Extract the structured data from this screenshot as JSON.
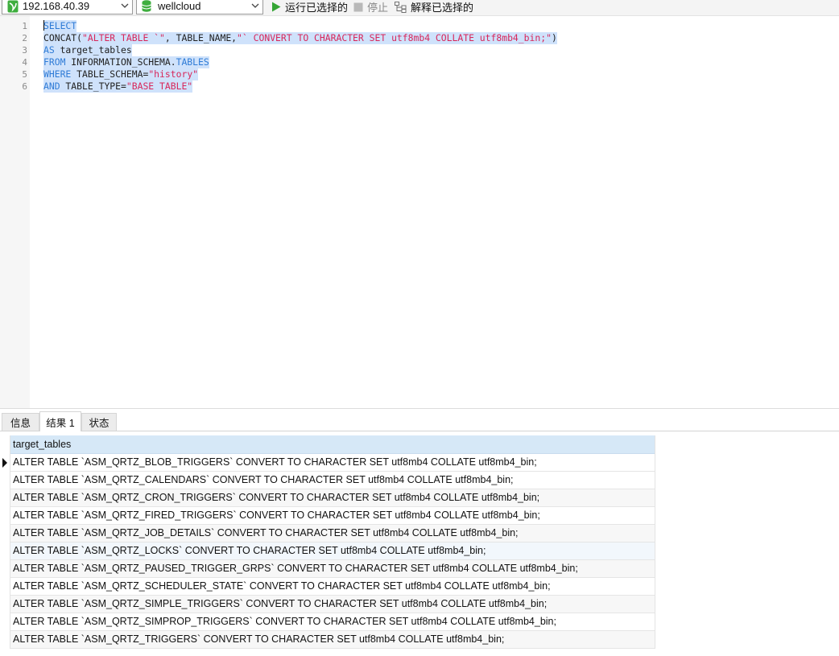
{
  "toolbar": {
    "connection": "192.168.40.39",
    "database": "wellcloud",
    "run_selected_label": "运行已选择的",
    "stop_label": "停止",
    "explain_selected_label": "解释已选择的"
  },
  "editor": {
    "lines": [
      {
        "num": "1",
        "tokens": [
          {
            "t": "SELECT",
            "c": "kw"
          }
        ]
      },
      {
        "num": "2",
        "tokens": [
          {
            "t": "CONCAT(",
            "c": "plain"
          },
          {
            "t": "\"ALTER TABLE `\"",
            "c": "str"
          },
          {
            "t": ", TABLE_NAME,",
            "c": "plain"
          },
          {
            "t": "\"` CONVERT TO CHARACTER SET utf8mb4 COLLATE utf8mb4_bin;\"",
            "c": "str"
          },
          {
            "t": ")",
            "c": "plain"
          }
        ]
      },
      {
        "num": "3",
        "tokens": [
          {
            "t": "AS",
            "c": "kw"
          },
          {
            "t": " target_tables",
            "c": "plain"
          }
        ]
      },
      {
        "num": "4",
        "tokens": [
          {
            "t": "FROM",
            "c": "kw"
          },
          {
            "t": " INFORMATION_SCHEMA.",
            "c": "plain"
          },
          {
            "t": "TABLES",
            "c": "kw"
          }
        ]
      },
      {
        "num": "5",
        "tokens": [
          {
            "t": "WHERE",
            "c": "kw"
          },
          {
            "t": " TABLE_SCHEMA=",
            "c": "plain"
          },
          {
            "t": "\"history\"",
            "c": "str"
          }
        ]
      },
      {
        "num": "6",
        "tokens": [
          {
            "t": "AND",
            "c": "kw"
          },
          {
            "t": " TABLE_TYPE=",
            "c": "plain"
          },
          {
            "t": "\"BASE TABLE\"",
            "c": "str"
          }
        ]
      }
    ]
  },
  "tabs": {
    "info": "信息",
    "result": "结果 1",
    "status": "状态"
  },
  "result": {
    "column": "target_tables",
    "rows": [
      "ALTER TABLE `ASM_QRTZ_BLOB_TRIGGERS` CONVERT TO CHARACTER SET utf8mb4 COLLATE utf8mb4_bin;",
      "ALTER TABLE `ASM_QRTZ_CALENDARS` CONVERT TO CHARACTER SET utf8mb4 COLLATE utf8mb4_bin;",
      "ALTER TABLE `ASM_QRTZ_CRON_TRIGGERS` CONVERT TO CHARACTER SET utf8mb4 COLLATE utf8mb4_bin;",
      "ALTER TABLE `ASM_QRTZ_FIRED_TRIGGERS` CONVERT TO CHARACTER SET utf8mb4 COLLATE utf8mb4_bin;",
      "ALTER TABLE `ASM_QRTZ_JOB_DETAILS` CONVERT TO CHARACTER SET utf8mb4 COLLATE utf8mb4_bin;",
      "ALTER TABLE `ASM_QRTZ_LOCKS` CONVERT TO CHARACTER SET utf8mb4 COLLATE utf8mb4_bin;",
      "ALTER TABLE `ASM_QRTZ_PAUSED_TRIGGER_GRPS` CONVERT TO CHARACTER SET utf8mb4 COLLATE utf8mb4_bin;",
      "ALTER TABLE `ASM_QRTZ_SCHEDULER_STATE` CONVERT TO CHARACTER SET utf8mb4 COLLATE utf8mb4_bin;",
      "ALTER TABLE `ASM_QRTZ_SIMPLE_TRIGGERS` CONVERT TO CHARACTER SET utf8mb4 COLLATE utf8mb4_bin;",
      "ALTER TABLE `ASM_QRTZ_SIMPROP_TRIGGERS` CONVERT TO CHARACTER SET utf8mb4 COLLATE utf8mb4_bin;",
      "ALTER TABLE `ASM_QRTZ_TRIGGERS` CONVERT TO CHARACTER SET utf8mb4 COLLATE utf8mb4_bin;"
    ]
  }
}
